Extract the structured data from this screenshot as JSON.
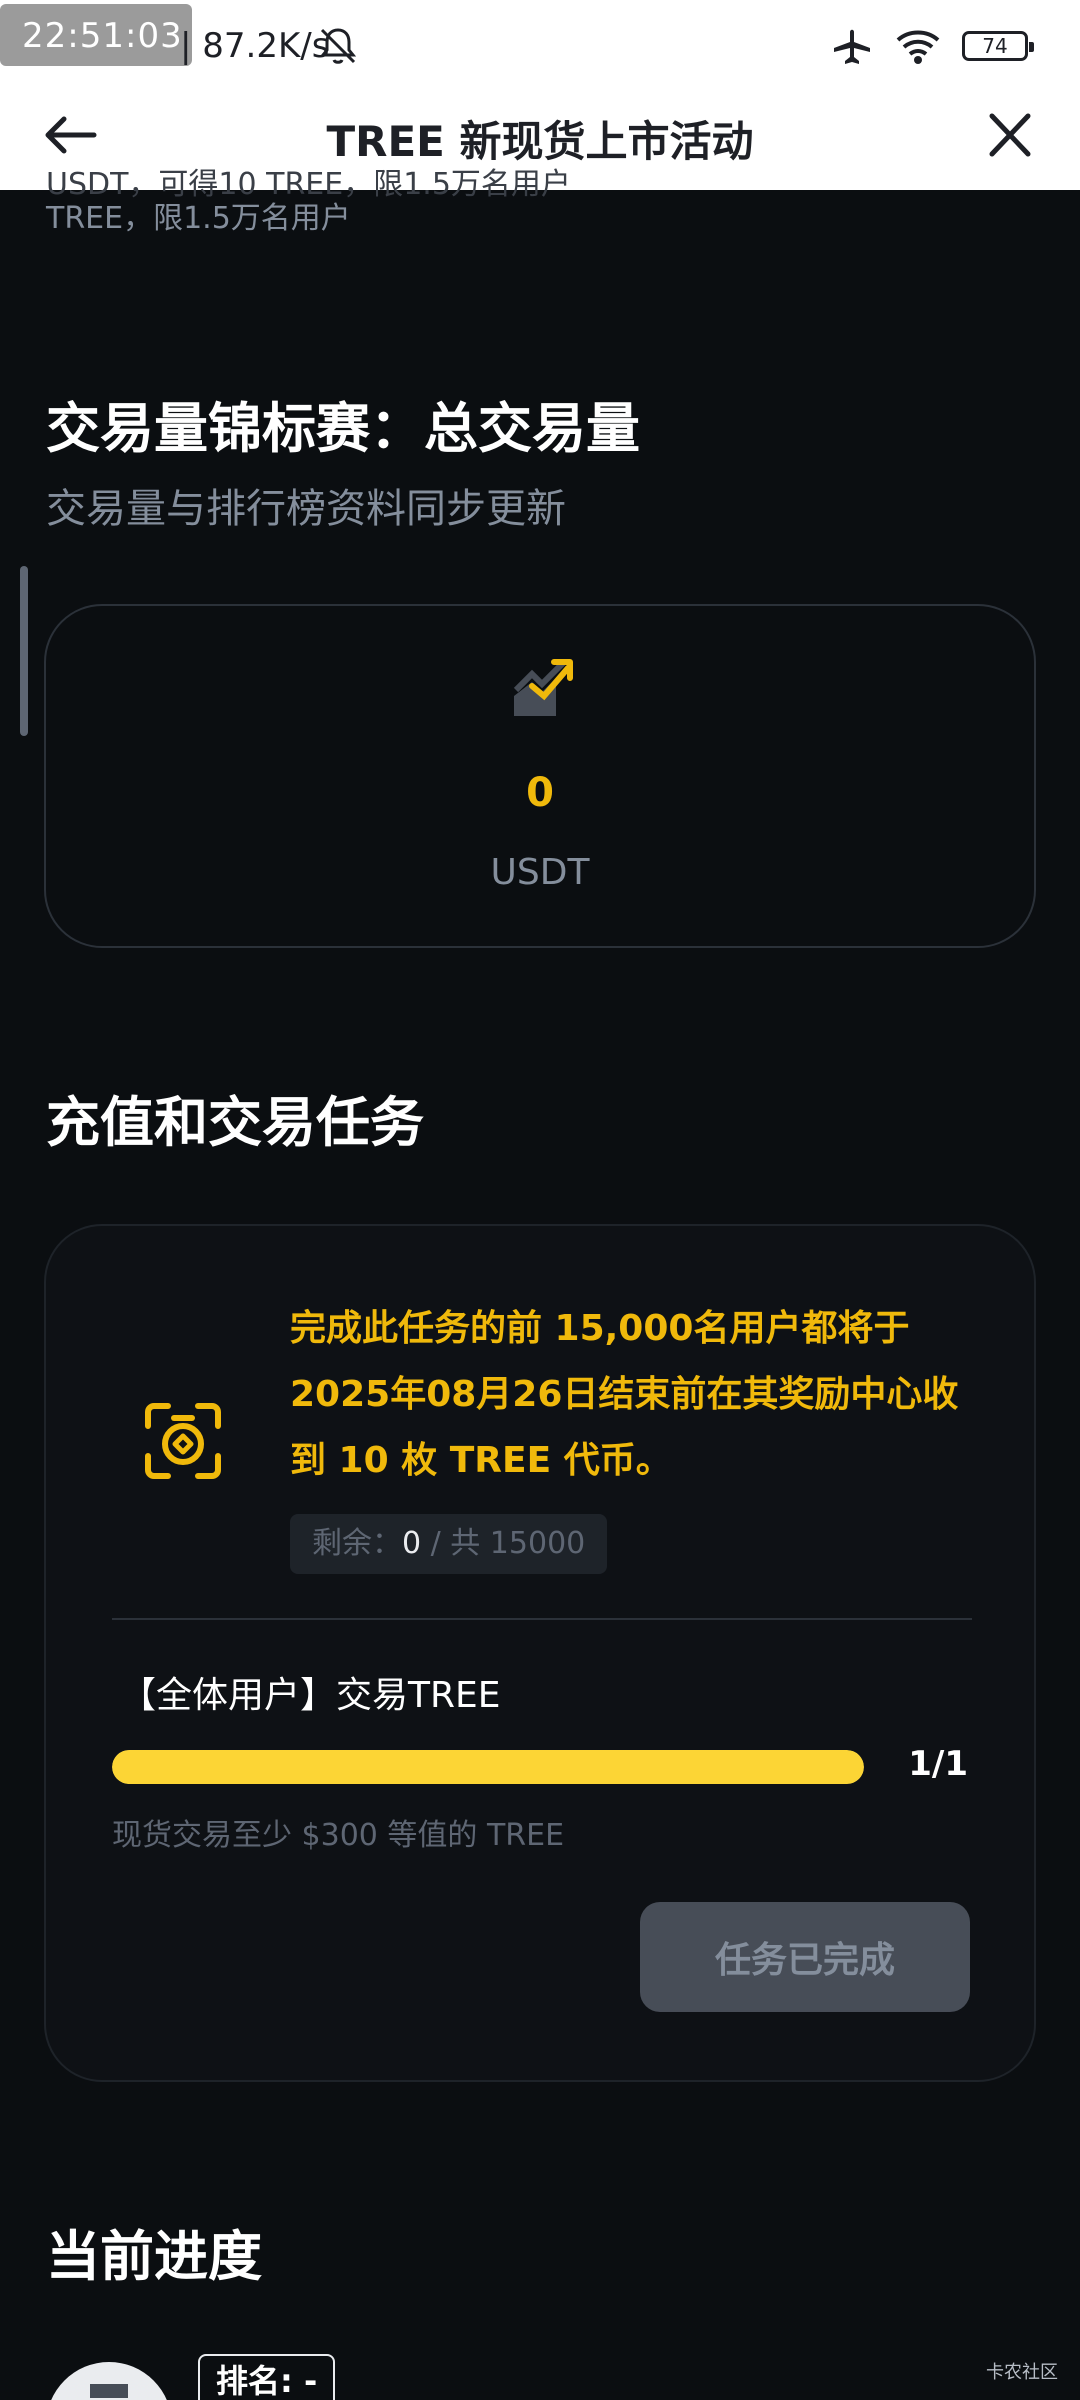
{
  "status_bar": {
    "time": "22:51:03",
    "speed": "| 87.2K/s",
    "battery": "74",
    "icons": [
      "mute-icon",
      "airplane-icon",
      "wifi-icon",
      "battery-icon"
    ]
  },
  "header": {
    "title": "TREE 新现货上市活动",
    "back_icon": "arrow-left-icon",
    "close_icon": "close-icon"
  },
  "clipped_text": {
    "line1": "USDT，可得10 TREE，限1.5万名用户",
    "line2": "TREE，限1.5万名用户"
  },
  "volume_section": {
    "title": "交易量锦标赛：总交易量",
    "subtitle": "交易量与排行榜资料同步更新",
    "icon": "trend-up-icon",
    "value": "0",
    "unit": "USDT"
  },
  "task_section": {
    "title": "充值和交易任务",
    "icon": "gift-icon",
    "description": "完成此任务的前 15,000名用户都将于 2025年08月26日结束前在其奖励中心收到 10 枚 TREE 代币。",
    "remaining_label": "剩余：",
    "remaining_value": "0",
    "total_label": " / 共 15000",
    "item_title": "【全体用户】交易TREE",
    "progress_text": "1/1",
    "progress_fraction": 1.0,
    "requirement": "现货交易至少 $300 等值的 TREE",
    "button_label": "任务已完成"
  },
  "progress_section": {
    "title": "当前进度",
    "rank_label": "排名: -"
  },
  "watermark": "卡农社区",
  "colors": {
    "background": "#0b0e11",
    "accent": "#f0b90b",
    "progress": "#fcd535",
    "muted": "#848e9c"
  }
}
